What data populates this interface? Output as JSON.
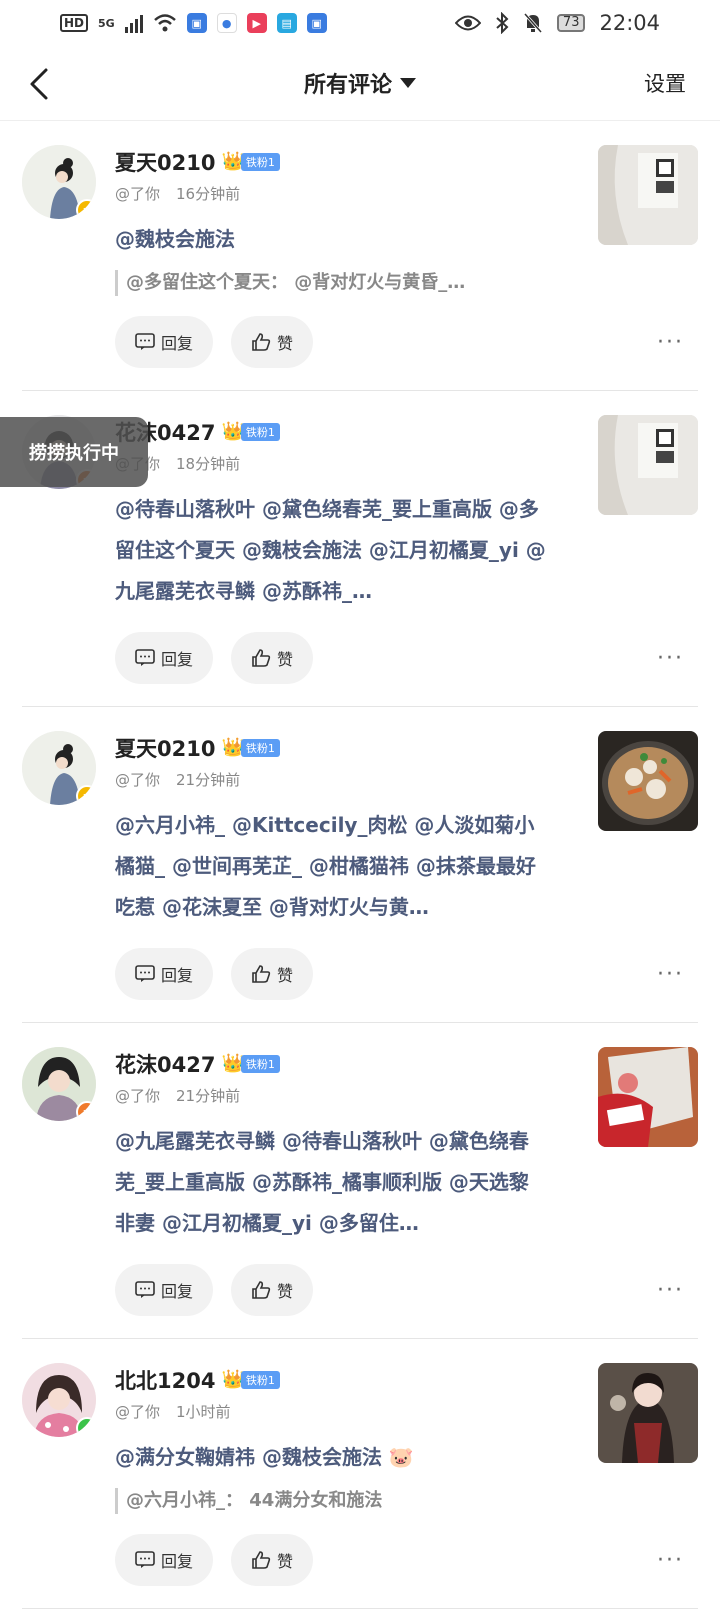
{
  "status_bar": {
    "network": "5G",
    "battery": "73",
    "time": "22:04"
  },
  "header": {
    "title": "所有评论",
    "settings": "设置"
  },
  "overlay": {
    "label": "捞捞执行中"
  },
  "actions": {
    "reply": "回复",
    "like": "赞"
  },
  "comments": [
    {
      "name": "夏天0210",
      "fan_level": "铁粉1",
      "badge_color": "#f5b800",
      "to": "@了你",
      "time": "16分钟前",
      "text": "@魏枝会施法",
      "quote": "@多留住这个夏天： @背对灯火与黄昏_…",
      "thumb": "white-shirt-qr-image"
    },
    {
      "name": "花沫0427",
      "fan_level": "铁粉1",
      "badge_color": "#f07a2a",
      "to": "@了你",
      "time": "18分钟前",
      "text": "@待春山落秋叶 @黛色绕春芜_要上重高版 @多留住这个夏天 @魏枝会施法 @江月初橘夏_yi @九尾露芜衣寻鳞 @苏酥祎_…",
      "quote": "",
      "thumb": "white-shirt-qr-image"
    },
    {
      "name": "夏天0210",
      "fan_level": "铁粉1",
      "badge_color": "#f5b800",
      "to": "@了你",
      "time": "21分钟前",
      "text": "@六月小祎_ @Kittcecily_肉松 @人淡如菊小橘猫_ @世间再芜芷_ @柑橘猫祎 @抹茶最最好吃惹 @花沫夏至 @背对灯火与黄…",
      "quote": "",
      "thumb": "food-pan-image"
    },
    {
      "name": "花沫0427",
      "fan_level": "铁粉1",
      "badge_color": "#f07a2a",
      "to": "@了你",
      "time": "21分钟前",
      "text": "@九尾露芜衣寻鳞 @待春山落秋叶 @黛色绕春芜_要上重高版 @苏酥祎_橘事顺利版 @天选黎非妻 @江月初橘夏_yi @多留住…",
      "quote": "",
      "thumb": "snack-bag-image"
    },
    {
      "name": "北北1204",
      "fan_level": "铁粉1",
      "badge_color": "#3cc34a",
      "to": "@了你",
      "time": "1小时前",
      "text": "@满分女鞠婧祎 @魏枝会施法 🐷",
      "quote": "@六月小祎_： 44满分女和施法",
      "thumb": "girl-costume-image"
    }
  ]
}
